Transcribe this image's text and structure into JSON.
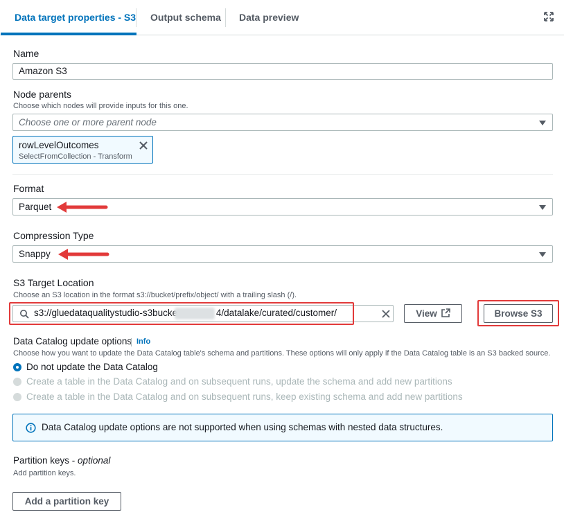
{
  "tabs": [
    {
      "label": "Data target properties - S3",
      "active": true
    },
    {
      "label": "Output schema",
      "active": false
    },
    {
      "label": "Data preview",
      "active": false
    }
  ],
  "name": {
    "label": "Name",
    "value": "Amazon S3"
  },
  "node_parents": {
    "label": "Node parents",
    "description": "Choose which nodes will provide inputs for this one.",
    "placeholder": "Choose one or more parent node",
    "token": {
      "title": "rowLevelOutcomes",
      "subtitle": "SelectFromCollection - Transform"
    }
  },
  "format": {
    "label": "Format",
    "value": "Parquet"
  },
  "compression": {
    "label": "Compression Type",
    "value": "Snappy"
  },
  "s3_target": {
    "label": "S3 Target Location",
    "description": "Choose an S3 location in the format s3://bucket/prefix/object/ with a trailing slash (/).",
    "value_start": "s3://gluedataqualitystudio-s3bucket",
    "value_end": "4/datalake/curated/customer/",
    "view_label": "View",
    "browse_label": "Browse S3"
  },
  "catalog": {
    "label": "Data Catalog update options",
    "info": "Info",
    "description": "Choose how you want to update the Data Catalog table's schema and partitions. These options will only apply if the Data Catalog table is an S3 backed source.",
    "options": [
      {
        "label": "Do not update the Data Catalog",
        "selected": true,
        "disabled": false
      },
      {
        "label": "Create a table in the Data Catalog and on subsequent runs, update the schema and add new partitions",
        "selected": false,
        "disabled": true
      },
      {
        "label": "Create a table in the Data Catalog and on subsequent runs, keep existing schema and add new partitions",
        "selected": false,
        "disabled": true
      }
    ],
    "alert": "Data Catalog update options are not supported when using schemas with nested data structures."
  },
  "partition": {
    "label": "Partition keys",
    "optional": "optional",
    "description": "Add partition keys.",
    "button": "Add a partition key"
  },
  "colors": {
    "accent": "#0073bb",
    "highlight": "#e23a3a",
    "border": "#aab7b8",
    "alert_bg": "#f1faff"
  },
  "icons": [
    "expand-icon",
    "remove-icon",
    "dropdown-caret-icon",
    "search-icon",
    "clear-icon",
    "external-link-icon",
    "info-icon",
    "arrow-annotation-icon"
  ]
}
